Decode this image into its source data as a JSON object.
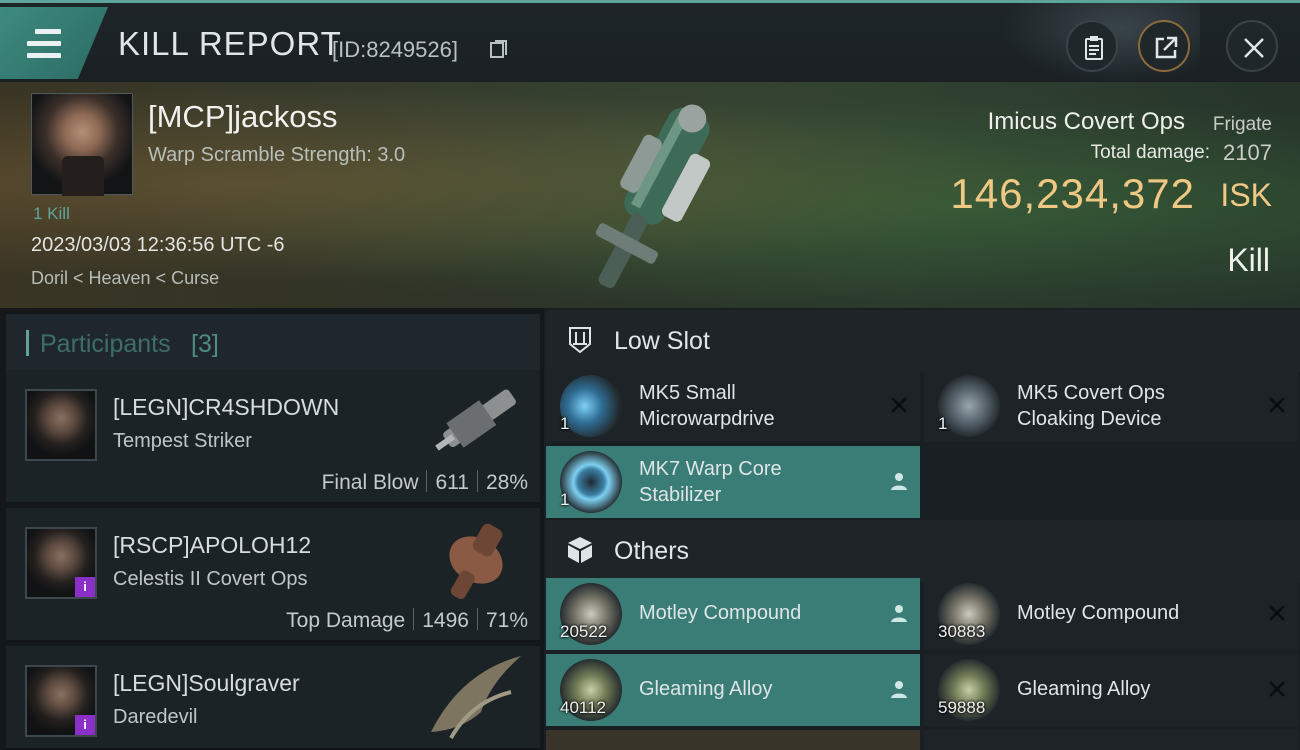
{
  "header": {
    "title": "KILL REPORT",
    "id_text": "[ID:8249526]",
    "buttons": [
      "clipboard-icon",
      "share-icon",
      "close-icon"
    ]
  },
  "victim": {
    "name": "[MCP]jackoss",
    "warp_scramble": "Warp Scramble Strength: 3.0",
    "kill_count": "1 Kill",
    "datetime": "2023/03/03 12:36:56 UTC -6",
    "location": "Doril < Heaven < Curse",
    "ship_name": "Imicus Covert Ops",
    "ship_class": "Frigate",
    "damage_label": "Total damage:",
    "damage_value": "2107",
    "isk_value": "146,234,372",
    "isk_unit": "ISK",
    "result": "Kill"
  },
  "participants": {
    "label": "Participants",
    "count": "[3]",
    "rows": [
      {
        "name": "[LEGN]CR4SHDOWN",
        "ship": "Tempest Striker",
        "role": "Final Blow",
        "damage": "611",
        "percent": "28%"
      },
      {
        "name": "[RSCP]APOLOH12",
        "ship": "Celestis II Covert Ops",
        "role": "Top Damage",
        "damage": "1496",
        "percent": "71%"
      },
      {
        "name": "[LEGN]Soulgraver",
        "ship": "Daredevil"
      }
    ]
  },
  "low_slot": {
    "label": "Low Slot",
    "items": [
      {
        "name": "MK5 Small Microwarpdrive",
        "qty": "1",
        "status": "destroyed"
      },
      {
        "name": "MK5 Covert Ops Cloaking Device",
        "qty": "1",
        "status": "destroyed"
      },
      {
        "name": "MK7 Warp Core Stabilizer",
        "qty": "1",
        "status": "dropped"
      }
    ]
  },
  "others": {
    "label": "Others",
    "items": [
      {
        "name": "Motley Compound",
        "qty": "20522",
        "status": "dropped"
      },
      {
        "name": "Motley Compound",
        "qty": "30883",
        "status": "destroyed"
      },
      {
        "name": "Gleaming Alloy",
        "qty": "40112",
        "status": "dropped"
      },
      {
        "name": "Gleaming Alloy",
        "qty": "59888",
        "status": "destroyed"
      }
    ]
  },
  "colors": {
    "accent": "#5fa49b",
    "isk": "#f0c885",
    "highlight": "#3a7d76",
    "corp_badge": "#8b2fc9"
  }
}
